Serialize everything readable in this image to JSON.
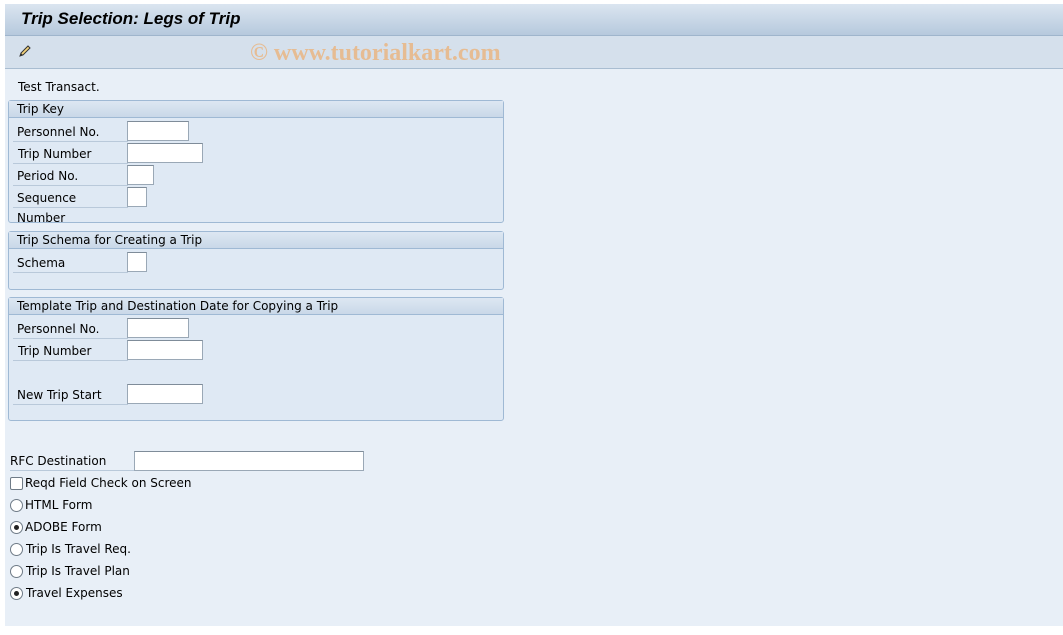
{
  "title": "Trip Selection: Legs of Trip",
  "toolbar": {
    "edit_icon": "pencil-icon",
    "watermark": "© www.tutorialkart.com"
  },
  "test_transact": "Test Transact.",
  "groups": [
    {
      "title": "Trip Key",
      "fields": [
        {
          "label": "Personnel No.",
          "value": ""
        },
        {
          "label": "Trip Number",
          "value": ""
        },
        {
          "label": "Period No.",
          "value": ""
        },
        {
          "label": "Sequence Number",
          "value": ""
        }
      ]
    },
    {
      "title": "Trip Schema for Creating a Trip",
      "fields": [
        {
          "label": "Schema",
          "value": ""
        }
      ]
    },
    {
      "title": "Template Trip and Destination Date for Copying a Trip",
      "fields": [
        {
          "label": "Personnel No.",
          "value": ""
        },
        {
          "label": "Trip Number",
          "value": ""
        },
        {
          "label": "New Trip Start",
          "value": ""
        }
      ]
    }
  ],
  "rfc": {
    "label": "RFC Destination",
    "value": ""
  },
  "checkbox": {
    "label": "Reqd Field Check on Screen",
    "checked": false
  },
  "radios1": [
    {
      "label": "HTML Form",
      "selected": false
    },
    {
      "label": "ADOBE Form",
      "selected": true
    }
  ],
  "radios2": [
    {
      "label": "Trip Is Travel Req.",
      "selected": false
    },
    {
      "label": "Trip Is Travel Plan",
      "selected": false
    },
    {
      "label": "Travel Expenses",
      "selected": true
    }
  ]
}
